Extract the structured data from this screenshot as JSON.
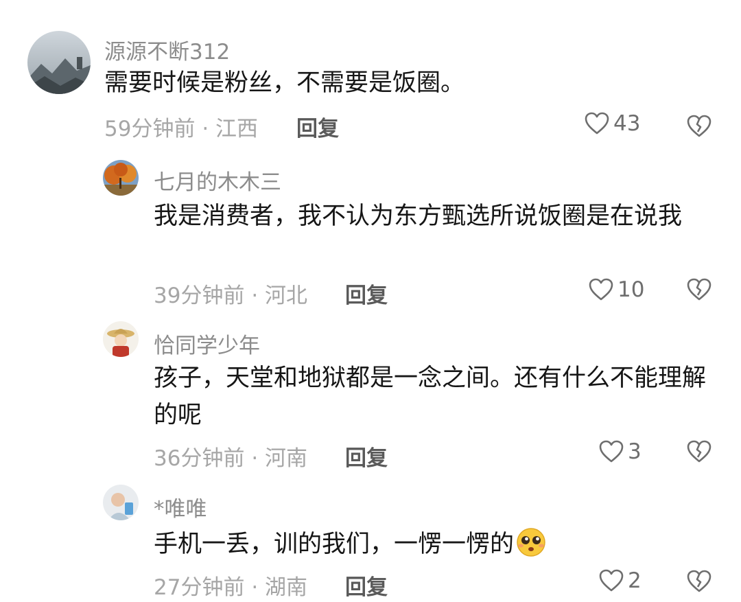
{
  "comments": [
    {
      "username": "源源不断312",
      "text": "需要时候是粉丝，不需要是饭圈。",
      "time": "59分钟前",
      "location": "江西",
      "likes": "43",
      "reply_label": "回复",
      "avatar_icon": "mountain-fog-avatar"
    },
    {
      "username": "七月的木木三",
      "text": "我是消费者，我不认为东方甄选所说饭圈是在说我",
      "time": "39分钟前",
      "location": "河北",
      "likes": "10",
      "reply_label": "回复",
      "avatar_icon": "autumn-tree-avatar"
    },
    {
      "username": "恰同学少年",
      "text": "孩子，天堂和地狱都是一念之间。还有什么不能理解的呢",
      "time": "36分钟前",
      "location": "河南",
      "likes": "3",
      "reply_label": "回复",
      "avatar_icon": "straw-hat-character-avatar"
    },
    {
      "username": "*唯唯",
      "text": "手机一丢，训的我们，一愣一愣的",
      "time": "27分钟前",
      "location": "湖南",
      "likes": "2",
      "reply_label": "回复",
      "emoji": "pleading-face-emoji",
      "avatar_icon": "person-photo-avatar"
    }
  ],
  "meta_separator": "·",
  "colors": {
    "username": "#8c8c8c",
    "text": "#161616",
    "meta": "#a6a6a6",
    "reply": "#5a5a5a"
  }
}
